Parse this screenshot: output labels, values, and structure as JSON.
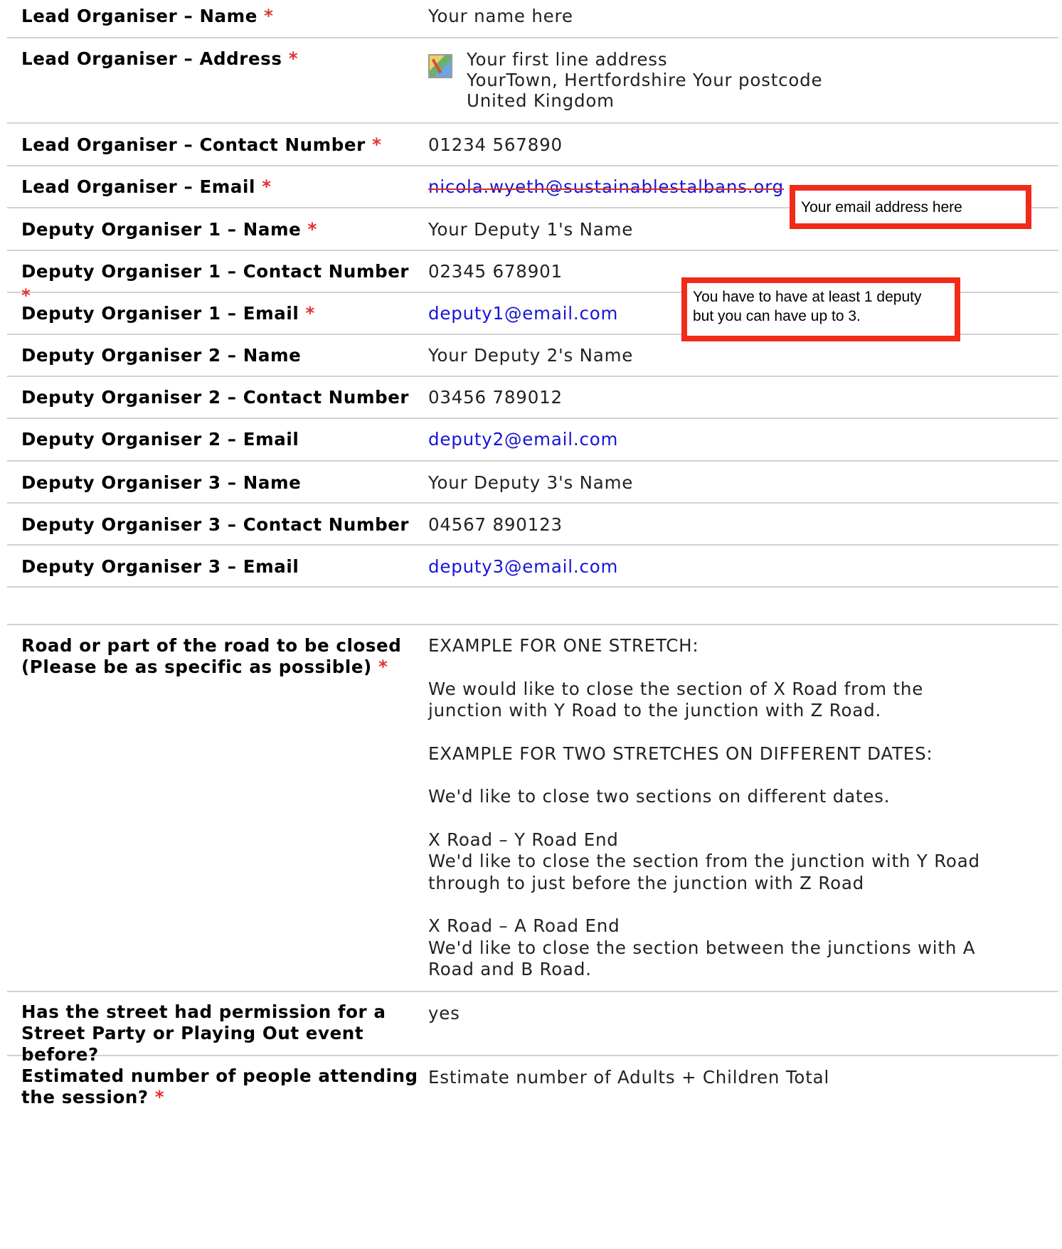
{
  "rows": [
    {
      "label": "Lead Organiser – Name",
      "required": "*",
      "value": "Your name here"
    },
    {
      "label": "Lead Organiser – Address",
      "required": "*",
      "address": [
        "Your first line address",
        "YourTown, Hertfordshire Your postcode",
        "United Kingdom"
      ]
    },
    {
      "label": "Lead Organiser – Contact Number",
      "required": "*",
      "value": "01234 567890"
    },
    {
      "label": "Lead Organiser – Email",
      "required": "*",
      "value": "nicola.wyeth@sustainablestalbans.org"
    },
    {
      "label": "Deputy Organiser 1 – Name",
      "required": "*",
      "value": "Your Deputy 1's Name"
    },
    {
      "label": "Deputy Organiser 1 – Contact Number",
      "required": "*",
      "value": "02345 678901"
    },
    {
      "label": "Deputy Organiser 1 – Email",
      "required": "*",
      "value": "deputy1@email.com"
    },
    {
      "label": "Deputy Organiser 2 – Name",
      "value": "Your Deputy 2's Name"
    },
    {
      "label": "Deputy Organiser 2 – Contact Number",
      "value": "03456 789012"
    },
    {
      "label": "Deputy Organiser 2 – Email",
      "value": "deputy2@email.com"
    },
    {
      "label": "Deputy Organiser 3 – Name",
      "value": "Your Deputy 3's Name"
    },
    {
      "label": "Deputy Organiser 3 – Contact Number",
      "value": "04567 890123"
    },
    {
      "label": "Deputy Organiser 3 – Email",
      "value": "deputy3@email.com"
    }
  ],
  "road": {
    "label_line1": "Road or part of the road to be closed",
    "label_line2": "(Please be as specific as possible)",
    "required": "*",
    "paragraphs": [
      "EXAMPLE FOR ONE STRETCH:",
      "We would like to close the section of X Road from the junction with Y Road to the junction with Z Road.",
      "EXAMPLE FOR TWO STRETCHES ON DIFFERENT DATES:",
      "We'd like to close two sections on different dates.",
      "X Road – Y Road End",
      "We'd like to close the section from the junction with Y Road through to just before the junction with Z Road",
      "X Road – A Road End",
      "We'd like to close the section between the junctions with A Road and B Road."
    ]
  },
  "permission": {
    "label_line1": "Has the street had permission for a",
    "label_line2": "Street Party or Playing Out event before?",
    "value": "yes"
  },
  "estimate": {
    "label_line1": "Estimated number of people attending",
    "label_line2": "the session?",
    "required": "*",
    "value": "Estimate number of Adults + Children Total"
  },
  "annotations": {
    "email_note": "Your email address here",
    "deputy_note_line1": "You have to have at least 1 deputy",
    "deputy_note_line2": "but you can have up to 3."
  },
  "colors": {
    "required": "#e03030",
    "link": "#1515d6",
    "annotation_border": "#f22a18",
    "divider": "#d2d2d2"
  },
  "icons": {
    "address": "map-icon"
  }
}
